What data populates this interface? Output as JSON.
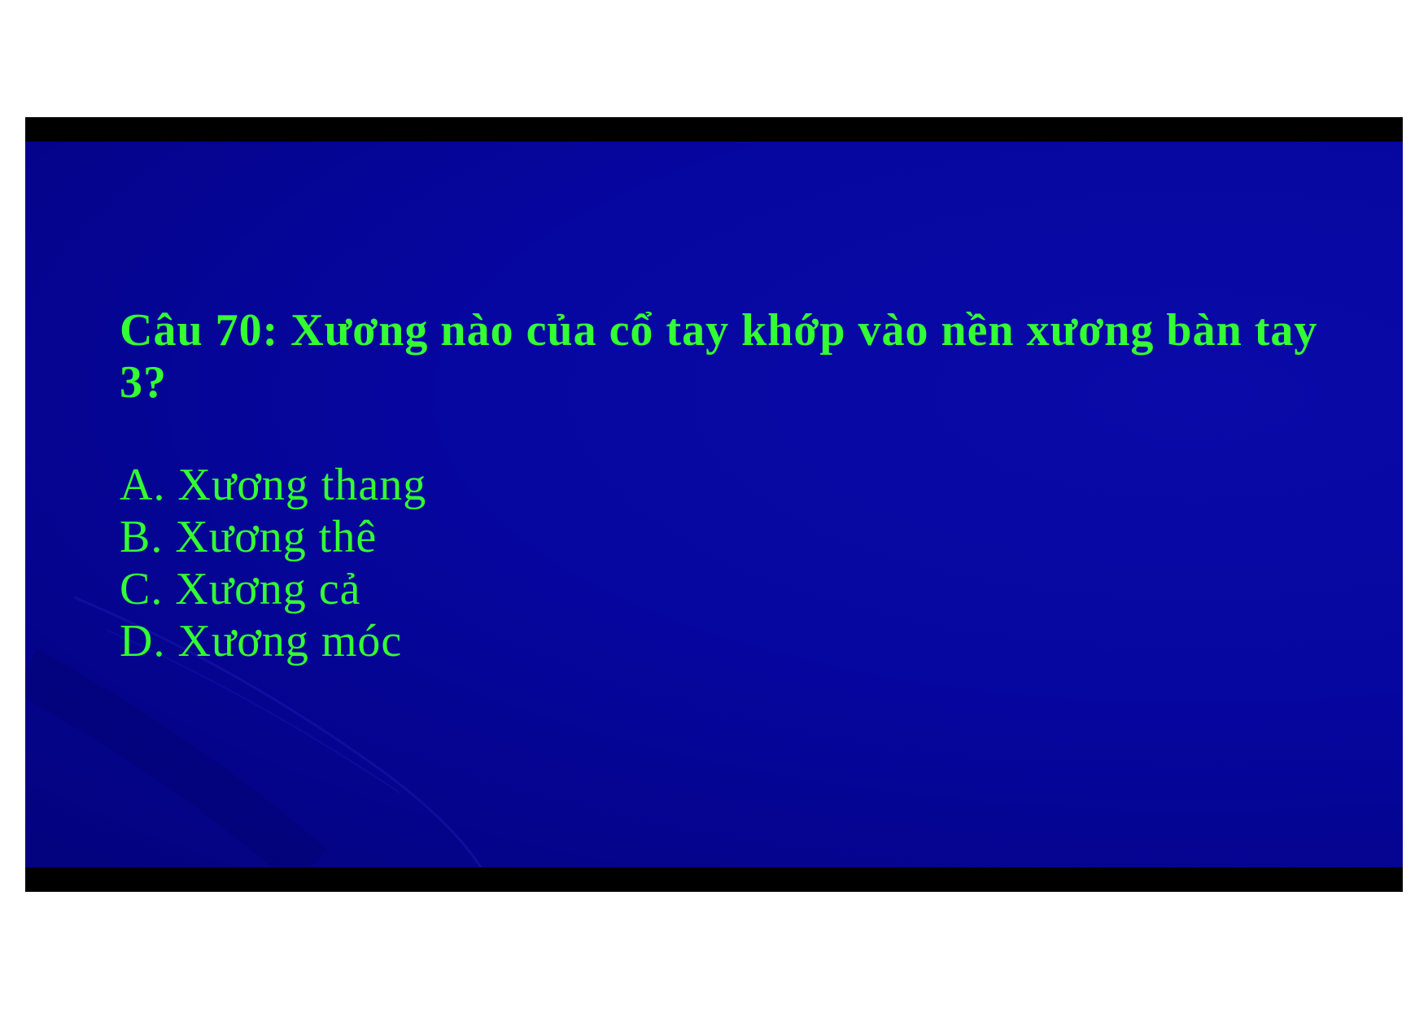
{
  "slide": {
    "question": "Câu 70: Xương nào của cổ tay khớp vào nền xương bàn tay 3?",
    "options": [
      "A. Xương thang",
      "B. Xương thê",
      "C. Xương cả",
      "D. Xương móc"
    ]
  },
  "colors": {
    "background": "#0606a0",
    "text": "#33ff33",
    "frame": "#000000",
    "page": "#ffffff"
  }
}
